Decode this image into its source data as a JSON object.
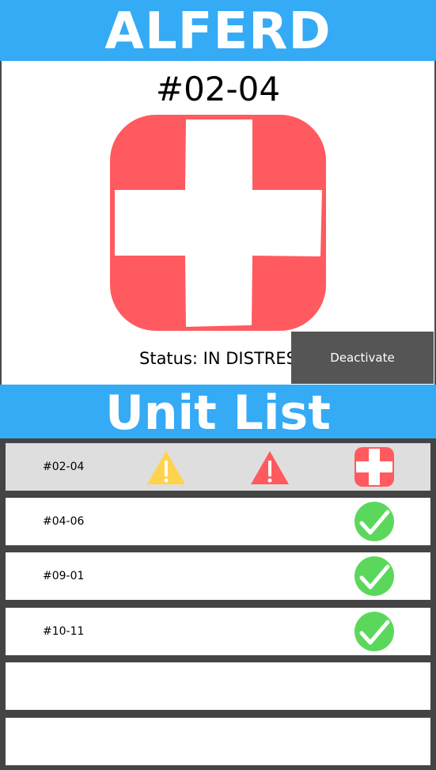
{
  "header": {
    "title": "ALFERD"
  },
  "detail": {
    "unit": "#02-04",
    "status_text": "Status: IN DISTRESS",
    "deactivate_label": "Deactivate",
    "icon": "medical-cross-icon"
  },
  "list": {
    "title": "Unit List",
    "rows": [
      {
        "label": "#02-04",
        "selected": true,
        "icons": [
          "yellow-warning-icon",
          "red-warning-icon",
          "medical-cross-icon"
        ]
      },
      {
        "label": "#04-06",
        "selected": false,
        "icons": [
          "ok-check-icon"
        ]
      },
      {
        "label": "#09-01",
        "selected": false,
        "icons": [
          "ok-check-icon"
        ]
      },
      {
        "label": "#10-11",
        "selected": false,
        "icons": [
          "ok-check-icon"
        ]
      },
      {
        "label": "",
        "selected": false,
        "icons": []
      },
      {
        "label": "",
        "selected": false,
        "icons": []
      }
    ]
  },
  "colors": {
    "accent_blue": "#35aaf5",
    "distress_red": "#ff5a5f",
    "ok_green": "#5bd85b",
    "warning_yellow": "#ffd34d",
    "button_gray": "#555555"
  }
}
